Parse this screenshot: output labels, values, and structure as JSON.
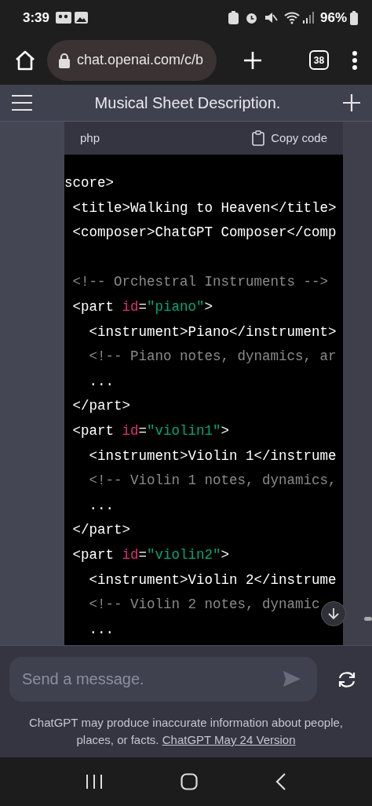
{
  "status_bar": {
    "time": "3:39",
    "battery": "96%"
  },
  "browser": {
    "url": "chat.openai.com/c/b",
    "tab_count": "38"
  },
  "header": {
    "title": "Musical Sheet Description."
  },
  "code_block": {
    "language": "php",
    "copy_label": "Copy code",
    "lines": [
      {
        "kind": "code",
        "segments": [
          {
            "kind": "tag",
            "text": "score>"
          }
        ]
      },
      {
        "kind": "code",
        "segments": [
          {
            "kind": "tag",
            "text": " <title>Walking to Heaven</title>"
          }
        ]
      },
      {
        "kind": "code",
        "segments": [
          {
            "kind": "tag",
            "text": " <composer>ChatGPT Composer</comp"
          }
        ]
      },
      {
        "kind": "blank"
      },
      {
        "kind": "code",
        "segments": [
          {
            "kind": "comment",
            "text": " <!-- Orchestral Instruments -->"
          }
        ]
      },
      {
        "kind": "code",
        "segments": [
          {
            "kind": "tag",
            "text": " <part "
          },
          {
            "kind": "attr",
            "text": "id"
          },
          {
            "kind": "tag",
            "text": "="
          },
          {
            "kind": "string",
            "text": "\"piano\""
          },
          {
            "kind": "tag",
            "text": ">"
          }
        ]
      },
      {
        "kind": "code",
        "segments": [
          {
            "kind": "tag",
            "text": "   <instrument>Piano</instrument>"
          }
        ]
      },
      {
        "kind": "code",
        "segments": [
          {
            "kind": "comment",
            "text": "   <!-- Piano notes, dynamics, ar"
          }
        ]
      },
      {
        "kind": "code",
        "segments": [
          {
            "kind": "tag",
            "text": "   ..."
          }
        ]
      },
      {
        "kind": "code",
        "segments": [
          {
            "kind": "tag",
            "text": " </part>"
          }
        ]
      },
      {
        "kind": "code",
        "segments": [
          {
            "kind": "tag",
            "text": " <part "
          },
          {
            "kind": "attr",
            "text": "id"
          },
          {
            "kind": "tag",
            "text": "="
          },
          {
            "kind": "string",
            "text": "\"violin1\""
          },
          {
            "kind": "tag",
            "text": ">"
          }
        ]
      },
      {
        "kind": "code",
        "segments": [
          {
            "kind": "tag",
            "text": "   <instrument>Violin 1</instrume"
          }
        ]
      },
      {
        "kind": "code",
        "segments": [
          {
            "kind": "comment",
            "text": "   <!-- Violin 1 notes, dynamics,"
          }
        ]
      },
      {
        "kind": "code",
        "segments": [
          {
            "kind": "tag",
            "text": "   ..."
          }
        ]
      },
      {
        "kind": "code",
        "segments": [
          {
            "kind": "tag",
            "text": " </part>"
          }
        ]
      },
      {
        "kind": "code",
        "segments": [
          {
            "kind": "tag",
            "text": " <part "
          },
          {
            "kind": "attr",
            "text": "id"
          },
          {
            "kind": "tag",
            "text": "="
          },
          {
            "kind": "string",
            "text": "\"violin2\""
          },
          {
            "kind": "tag",
            "text": ">"
          }
        ]
      },
      {
        "kind": "code",
        "segments": [
          {
            "kind": "tag",
            "text": "   <instrument>Violin 2</instrume"
          }
        ]
      },
      {
        "kind": "code",
        "segments": [
          {
            "kind": "comment",
            "text": "   <!-- Violin 2 notes, dynamic"
          }
        ]
      },
      {
        "kind": "code",
        "segments": [
          {
            "kind": "tag",
            "text": "   ..."
          }
        ]
      }
    ]
  },
  "composer": {
    "placeholder": "Send a message."
  },
  "disclaimer": {
    "text": "ChatGPT may produce inaccurate information about people, places, or facts.",
    "link": "ChatGPT May 24 Version"
  }
}
